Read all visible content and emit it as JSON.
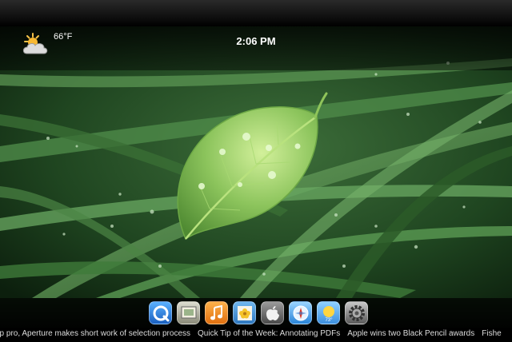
{
  "status_bar": {
    "temperature": "66°F",
    "time": "2:06 PM",
    "weather_icon": "partly-cloudy-icon"
  },
  "dock": {
    "apps": [
      {
        "icon": "quicktime-icon"
      },
      {
        "icon": "preview-app-icon"
      },
      {
        "icon": "music-note-icon"
      },
      {
        "icon": "iphoto-icon"
      },
      {
        "icon": "apple-icon"
      },
      {
        "icon": "safari-compass-icon"
      },
      {
        "icon": "weather-sun-icon"
      },
      {
        "icon": "settings-gear-icon"
      }
    ]
  },
  "news_ticker": {
    "items": [
      "op pro, Aperture makes short work of selection process",
      "Quick Tip of the Week: Annotating PDFs",
      "Apple wins two Black Pencil awards",
      "Fishe"
    ]
  },
  "colors": {
    "grass_dark": "#0f2a12",
    "grass_light": "#5f9a5a",
    "leaf": "#9fd06a",
    "bar": "#000000"
  }
}
